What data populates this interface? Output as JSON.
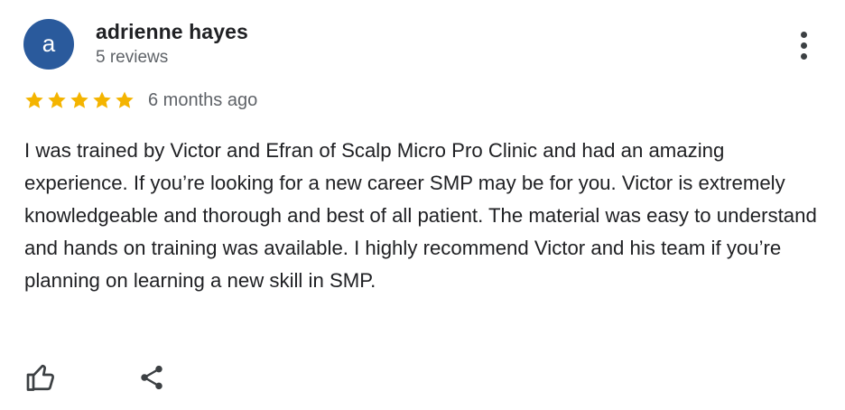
{
  "reviewer": {
    "avatar_letter": "a",
    "avatar_color": "#2a5a9c",
    "name": "adrienne hayes",
    "review_count": "5 reviews"
  },
  "review": {
    "rating": 5,
    "rating_max": 5,
    "star_color": "#f4b400",
    "time_ago": "6 months ago",
    "text": "I was trained by Victor and Efran of Scalp Micro Pro Clinic and had an amazing experience. If you’re looking for a new career SMP may be for you. Victor is extremely knowledgeable and thorough and best of all patient. The material was easy to understand and hands on training was available. I highly recommend Victor and his team if you’re planning on learning a new skill in SMP."
  },
  "icons": {
    "more": "more-vert-icon",
    "like": "thumb-up-icon",
    "share": "share-icon"
  }
}
